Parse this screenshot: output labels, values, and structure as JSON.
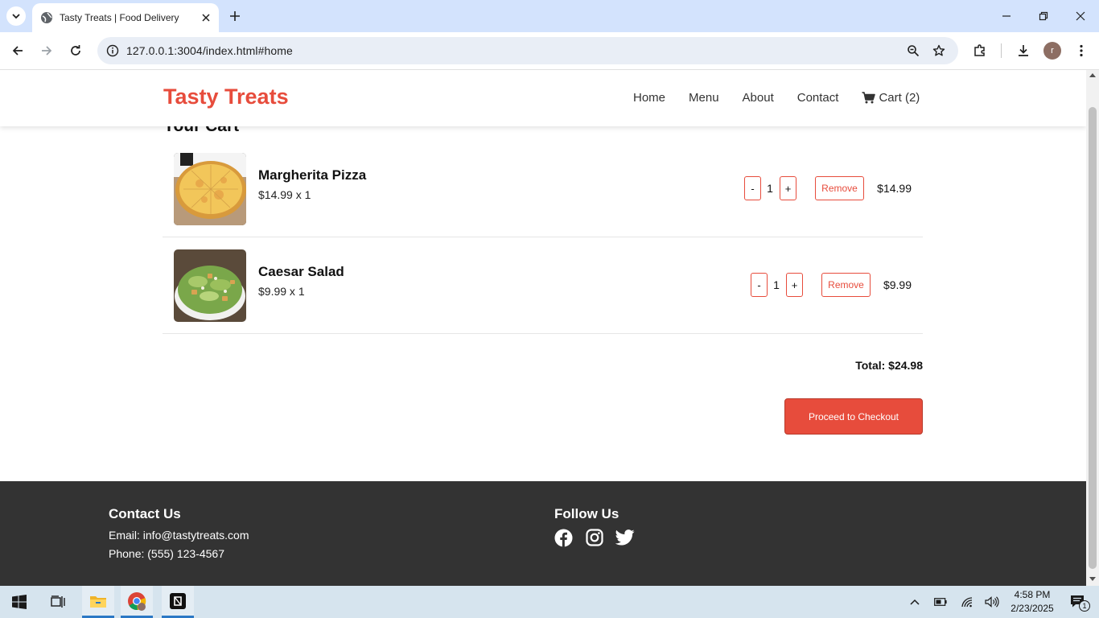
{
  "browser": {
    "tab_title": "Tasty Treats | Food Delivery",
    "url": "127.0.0.1:3004/index.html#home",
    "profile_initial": "r"
  },
  "site": {
    "logo": "Tasty Treats",
    "brand_color": "#e74c3c",
    "nav": [
      "Home",
      "Menu",
      "About",
      "Contact"
    ],
    "cart_label": "Cart (2)"
  },
  "cart": {
    "heading": "Your Cart",
    "items": [
      {
        "name": "Margherita Pizza",
        "unit_line": "$14.99 x 1",
        "qty": "1",
        "dec": "-",
        "inc": "+",
        "remove": "Remove",
        "line_total": "$14.99",
        "image": "pizza"
      },
      {
        "name": "Caesar Salad",
        "unit_line": "$9.99 x 1",
        "qty": "1",
        "dec": "-",
        "inc": "+",
        "remove": "Remove",
        "line_total": "$9.99",
        "image": "salad"
      }
    ],
    "total": "Total: $24.98",
    "checkout": "Proceed to Checkout"
  },
  "footer": {
    "contact_heading": "Contact Us",
    "email": "Email: info@tastytreats.com",
    "phone": "Phone: (555) 123-4567",
    "follow_heading": "Follow Us",
    "social_icons": [
      "facebook-icon",
      "instagram-icon",
      "twitter-icon"
    ]
  },
  "taskbar": {
    "time": "4:58 PM",
    "date": "2/23/2025",
    "notification_count": "1"
  }
}
